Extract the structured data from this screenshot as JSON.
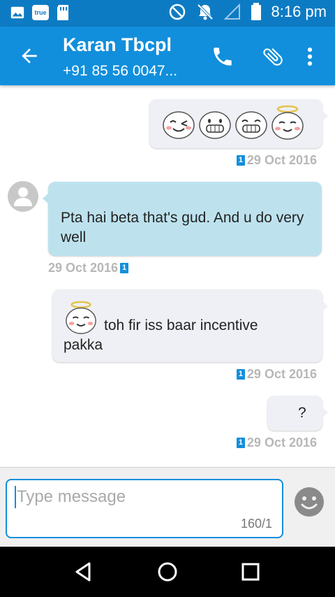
{
  "status_bar": {
    "time": "8:16 pm",
    "icons": [
      "image-icon",
      "truecaller-icon",
      "sd-card-icon",
      "do-not-disturb-icon",
      "notifications-off-icon",
      "signal-icon",
      "battery-icon"
    ]
  },
  "app_bar": {
    "contact_name": "Karan Tbcpl",
    "contact_number": "+91 85 56 0047...",
    "icons": [
      "back-arrow-icon",
      "phone-icon",
      "attachment-icon",
      "more-vert-icon"
    ]
  },
  "messages": [
    {
      "direction": "outgoing",
      "emojis": [
        "wink-face",
        "grin-face",
        "grin-face",
        "angel-face"
      ],
      "text": "",
      "timestamp": "29 Oct 2016",
      "sim": "1"
    },
    {
      "direction": "incoming",
      "text": "Pta hai beta that's gud. And u do very well",
      "timestamp": "29 Oct 2016",
      "sim": "1"
    },
    {
      "direction": "outgoing",
      "emojis": [
        "angel-face"
      ],
      "text": "toh fir iss baar incentive pakka",
      "timestamp": "29 Oct 2016",
      "sim": "1"
    },
    {
      "direction": "outgoing",
      "text": "?",
      "timestamp": "29 Oct 2016",
      "sim": "1"
    }
  ],
  "composer": {
    "placeholder": "Type message",
    "counter": "160/1"
  },
  "colors": {
    "status_bar": "#0d7bc4",
    "app_bar": "#118fdc",
    "incoming_bubble": "#bde2ee",
    "outgoing_bubble": "#eef0f5"
  }
}
